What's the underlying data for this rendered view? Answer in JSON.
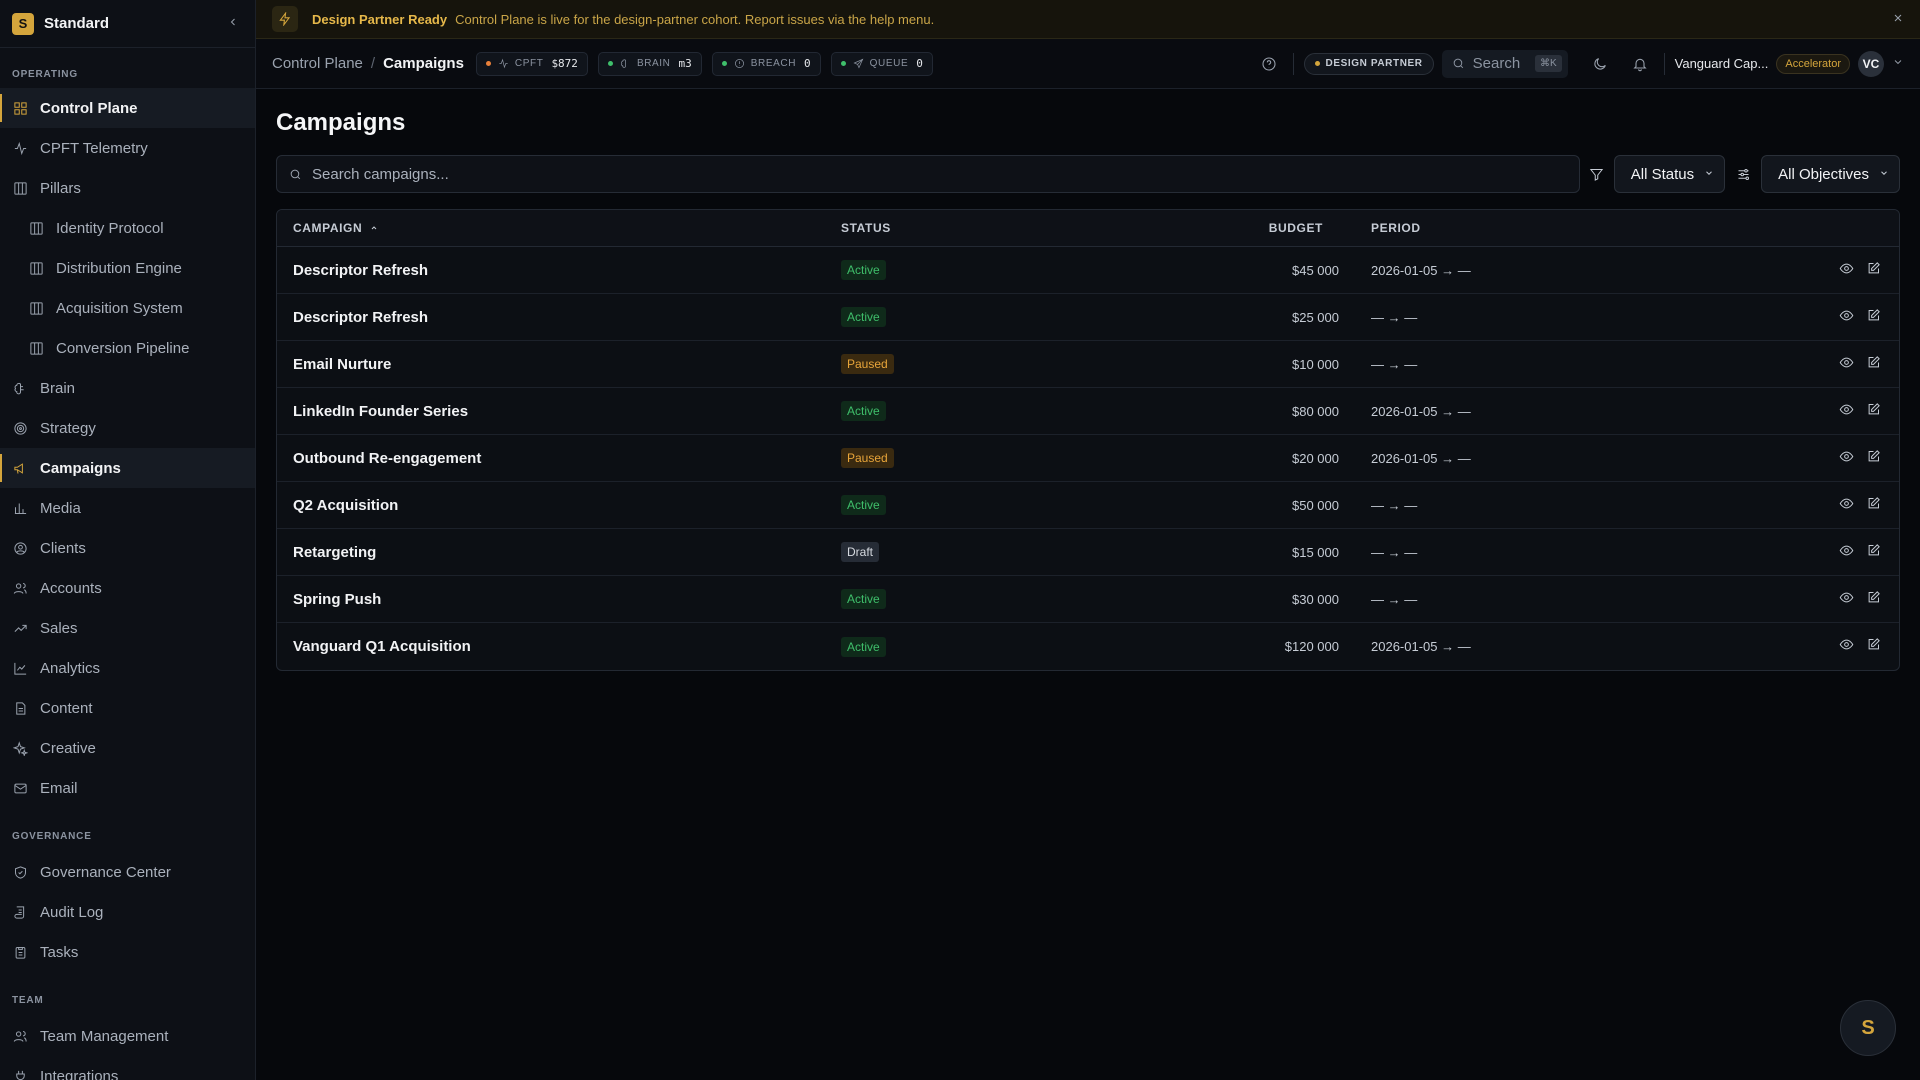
{
  "sidebar": {
    "brand_letter": "S",
    "brand_name": "Standard",
    "sections": [
      {
        "label": "OPERATING"
      },
      {
        "label": "GOVERNANCE"
      },
      {
        "label": "TEAM"
      }
    ],
    "items": [
      {
        "label": "Control Plane",
        "icon": "grid-icon"
      },
      {
        "label": "CPFT Telemetry",
        "icon": "activity-icon"
      },
      {
        "label": "Pillars",
        "icon": "columns-icon"
      },
      {
        "label": "Identity Protocol",
        "icon": "columns-icon"
      },
      {
        "label": "Distribution Engine",
        "icon": "columns-icon"
      },
      {
        "label": "Acquisition System",
        "icon": "columns-icon"
      },
      {
        "label": "Conversion Pipeline",
        "icon": "columns-icon"
      },
      {
        "label": "Brain",
        "icon": "brain-icon"
      },
      {
        "label": "Strategy",
        "icon": "target-icon"
      },
      {
        "label": "Campaigns",
        "icon": "megaphone-icon"
      },
      {
        "label": "Media",
        "icon": "bar-chart-icon"
      },
      {
        "label": "Clients",
        "icon": "user-circle-icon"
      },
      {
        "label": "Accounts",
        "icon": "users-icon"
      },
      {
        "label": "Sales",
        "icon": "trending-up-icon"
      },
      {
        "label": "Analytics",
        "icon": "line-chart-icon"
      },
      {
        "label": "Content",
        "icon": "file-text-icon"
      },
      {
        "label": "Creative",
        "icon": "sparkles-icon"
      },
      {
        "label": "Email",
        "icon": "mail-icon"
      },
      {
        "label": "Governance Center",
        "icon": "shield-icon"
      },
      {
        "label": "Audit Log",
        "icon": "scroll-icon"
      },
      {
        "label": "Tasks",
        "icon": "clipboard-icon"
      },
      {
        "label": "Team Management",
        "icon": "users-icon"
      },
      {
        "label": "Integrations",
        "icon": "plug-icon"
      }
    ]
  },
  "banner": {
    "title": "Design Partner Ready",
    "text": "Control Plane is live for the design-partner cohort. Report issues via the help menu."
  },
  "topbar": {
    "breadcrumb_root": "Control Plane",
    "breadcrumb_sep": "/",
    "breadcrumb_current": "Campaigns",
    "metrics": [
      {
        "label": "CPFT",
        "value": "$872",
        "dot": "#e8803a"
      },
      {
        "label": "BRAIN",
        "value": "m3",
        "dot": "#3fbf6b"
      },
      {
        "label": "BREACH",
        "value": "0",
        "dot": "#3fbf6b"
      },
      {
        "label": "QUEUE",
        "value": "0",
        "dot": "#3fbf6b"
      }
    ],
    "partner_pill": "DESIGN PARTNER",
    "search_label": "Search",
    "search_kbd": "⌘K",
    "org_name": "Vanguard Cap...",
    "tier": "Accelerator",
    "avatar": "VC"
  },
  "main": {
    "title": "Campaigns",
    "search_placeholder": "Search campaigns...",
    "status_filter": "All Status",
    "objective_filter": "All Objectives",
    "columns": {
      "campaign": "CAMPAIGN",
      "sort_indicator": "^",
      "status": "STATUS",
      "budget": "BUDGET",
      "period": "PERIOD"
    },
    "rows": [
      {
        "name": "Descriptor Refresh",
        "status": "Active",
        "budget": "$45 000",
        "period": "2026-01-05 → —"
      },
      {
        "name": "Descriptor Refresh",
        "status": "Active",
        "budget": "$25 000",
        "period": "— → —"
      },
      {
        "name": "Email Nurture",
        "status": "Paused",
        "budget": "$10 000",
        "period": "— → —"
      },
      {
        "name": "LinkedIn Founder Series",
        "status": "Active",
        "budget": "$80 000",
        "period": "2026-01-05 → —"
      },
      {
        "name": "Outbound Re-engagement",
        "status": "Paused",
        "budget": "$20 000",
        "period": "2026-01-05 → —"
      },
      {
        "name": "Q2 Acquisition",
        "status": "Active",
        "budget": "$50 000",
        "period": "— → —"
      },
      {
        "name": "Retargeting",
        "status": "Draft",
        "budget": "$15 000",
        "period": "— → —"
      },
      {
        "name": "Spring Push",
        "status": "Active",
        "budget": "$30 000",
        "period": "— → —"
      },
      {
        "name": "Vanguard Q1 Acquisition",
        "status": "Active",
        "budget": "$120 000",
        "period": "2026-01-05 → —"
      }
    ]
  },
  "fab_letter": "S",
  "colors": {
    "accent": "#d4a53c",
    "active": "#3fbf6b",
    "paused": "#e8a53a",
    "background": "#06080c"
  }
}
